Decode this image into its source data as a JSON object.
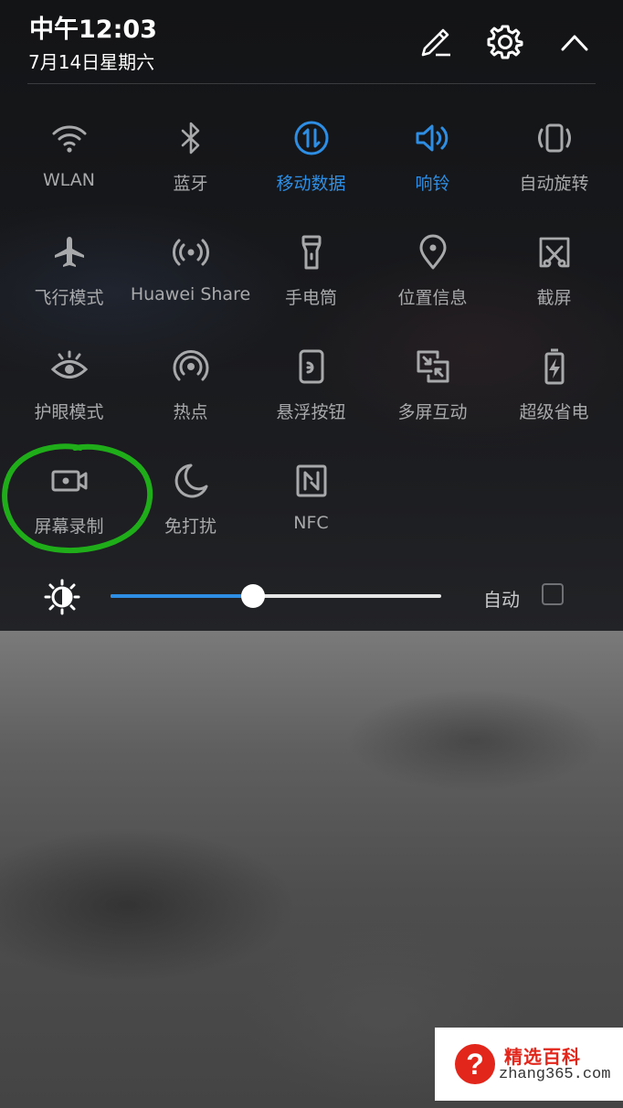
{
  "status": {
    "time": "中午12:03",
    "date": "7月14日星期六"
  },
  "header_actions": [
    {
      "icon": "edit-icon"
    },
    {
      "icon": "gear-icon"
    },
    {
      "icon": "chevron-up-icon"
    }
  ],
  "colors": {
    "accent": "#2e8ee4",
    "inactive": "#a8a9ab",
    "annotation": "#1fae1a",
    "watermark_red": "#e2261b"
  },
  "tiles": [
    {
      "label": "WLAN",
      "icon": "wifi-icon",
      "active": false
    },
    {
      "label": "蓝牙",
      "icon": "bluetooth-icon",
      "active": false
    },
    {
      "label": "移动数据",
      "icon": "mobile-data-icon",
      "active": true
    },
    {
      "label": "响铃",
      "icon": "speaker-icon",
      "active": true
    },
    {
      "label": "自动旋转",
      "icon": "auto-rotate-icon",
      "active": false
    },
    {
      "label": "飞行模式",
      "icon": "airplane-icon",
      "active": false
    },
    {
      "label": "Huawei Share",
      "icon": "huawei-share-icon",
      "active": false
    },
    {
      "label": "手电筒",
      "icon": "flashlight-icon",
      "active": false
    },
    {
      "label": "位置信息",
      "icon": "location-icon",
      "active": false
    },
    {
      "label": "截屏",
      "icon": "screenshot-icon",
      "active": false
    },
    {
      "label": "护眼模式",
      "icon": "eye-icon",
      "active": false
    },
    {
      "label": "热点",
      "icon": "hotspot-icon",
      "active": false
    },
    {
      "label": "悬浮按钮",
      "icon": "floating-button-icon",
      "active": false
    },
    {
      "label": "多屏互动",
      "icon": "multi-screen-icon",
      "active": false
    },
    {
      "label": "超级省电",
      "icon": "battery-saver-icon",
      "active": false
    },
    {
      "label": "屏幕录制",
      "icon": "screen-record-icon",
      "active": false
    },
    {
      "label": "免打扰",
      "icon": "moon-icon",
      "active": false
    },
    {
      "label": "NFC",
      "icon": "nfc-icon",
      "active": false
    }
  ],
  "brightness": {
    "icon": "brightness-icon",
    "level": 0.43,
    "auto_label": "自动",
    "auto_checked": false
  },
  "watermark": {
    "title": "精选百科",
    "url": "zhang365.com",
    "icon": "question-icon",
    "icon_glyph": "?"
  }
}
